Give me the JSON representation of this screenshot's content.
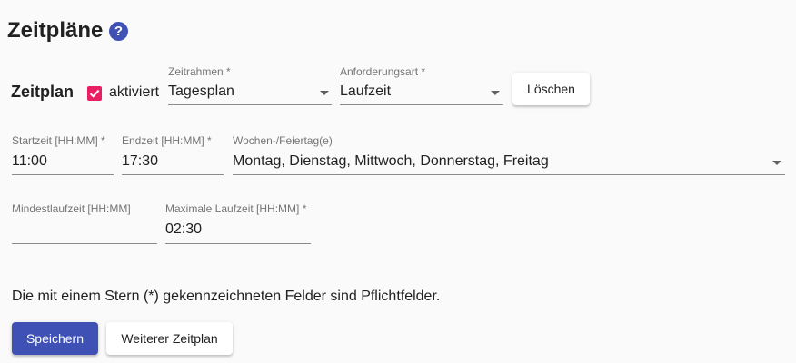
{
  "header": {
    "title": "Zeitpläne",
    "help_glyph": "?"
  },
  "schedule": {
    "section_label": "Zeitplan",
    "enabled_label": "aktiviert",
    "enabled": true,
    "frame": {
      "label": "Zeitrahmen *",
      "value": "Tagesplan"
    },
    "request_type": {
      "label": "Anforderungsart *",
      "value": "Laufzeit"
    },
    "delete_label": "Löschen",
    "start": {
      "label": "Startzeit [HH:MM] *",
      "value": "11:00"
    },
    "end": {
      "label": "Endzeit [HH:MM] *",
      "value": "17:30"
    },
    "weekdays": {
      "label": "Wochen-/Feiertag(e)",
      "value": "Montag, Dienstag, Mittwoch, Donnerstag, Freitag"
    },
    "min_runtime": {
      "label": "Mindestlaufzeit [HH:MM]",
      "value": ""
    },
    "max_runtime": {
      "label": "Maximale Laufzeit [HH:MM] *",
      "value": "02:30"
    }
  },
  "footer": {
    "required_note": "Die mit einem Stern (*) gekennzeichneten Felder sind Pflichtfelder.",
    "save_label": "Speichern",
    "add_label": "Weiterer Zeitplan"
  },
  "colors": {
    "primary": "#3f51b5",
    "accent": "#e91e63"
  },
  "icons": {
    "help": "help-circle-icon",
    "checkbox": "checkmark-icon",
    "dropdown": "chevron-down-icon"
  }
}
